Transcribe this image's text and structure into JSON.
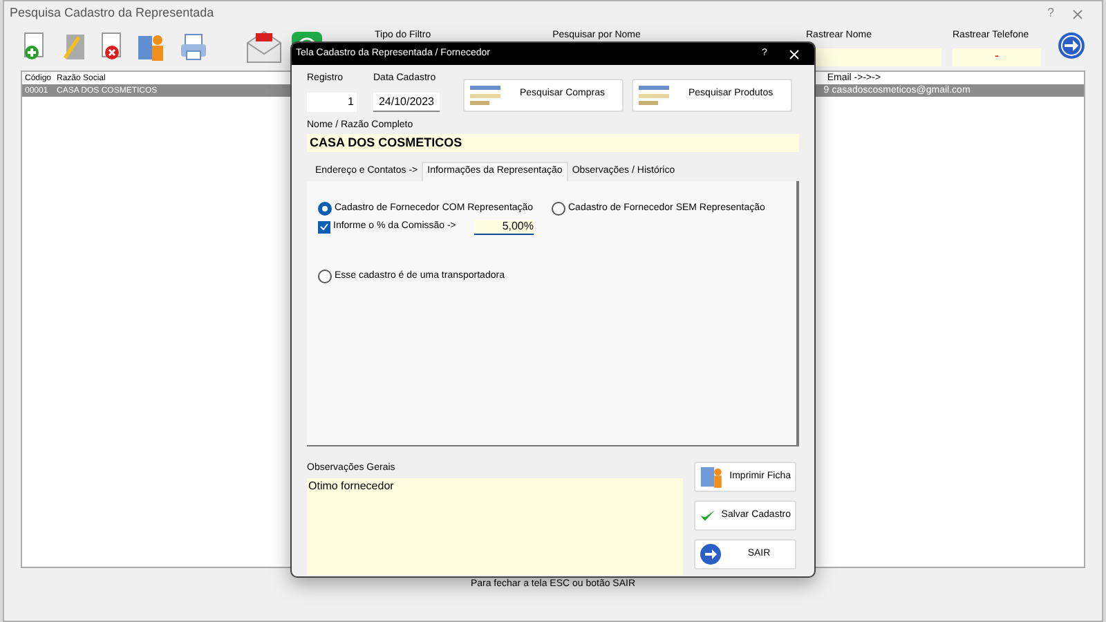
{
  "window": {
    "title": "Pesquisa Cadastro da Representada",
    "help": "?"
  },
  "filters": {
    "type_label": "Tipo do Filtro",
    "search_label": "Pesquisar por Nome",
    "track_name_label": "Rastrear Nome",
    "track_phone_label": "Rastrear Telefone",
    "track_phone_value": "-"
  },
  "table": {
    "columns": [
      "Código",
      "Razão Social",
      "Email ->->->"
    ],
    "rows": [
      {
        "code": "00001",
        "name": "CASA DOS COSMETICOS",
        "column_3": "9",
        "email": "casadoscosmeticos@gmail.com",
        "selected": true
      }
    ]
  },
  "status_bar": "Para fechar a tela ESC ou botão SAIR",
  "dialog": {
    "title": "Tela Cadastro da Representada / Fornecedor",
    "help": "?",
    "registro_label": "Registro",
    "registro": "1",
    "date_label": "Data Cadastro",
    "date": "24/10/2023",
    "top_buttons": [
      "Pesquisar Compras",
      "Pesquisar Produtos"
    ],
    "name_label": "Nome / Razão Completo",
    "name": "CASA DOS COSMETICOS",
    "tabs": [
      {
        "label": "Endereço e Contatos ->",
        "selected": false
      },
      {
        "label": "Informações da Representação",
        "selected": true
      },
      {
        "label": "Observações / Histórico",
        "selected": false
      }
    ],
    "radios": [
      {
        "label": "Cadastro de Fornecedor COM Representação",
        "selected": true
      },
      {
        "label": "Cadastro de Fornecedor SEM Representação",
        "selected": false
      }
    ],
    "commission": {
      "label": "Informe o % da Comissão ->",
      "checked": true,
      "value": "5,00%"
    },
    "carrier": {
      "label": "Esse cadastro é de uma transportadora",
      "selected": false
    },
    "notes_label": "Observações Gerais",
    "notes": "Otimo fornecedor",
    "actions": [
      {
        "kind": "print",
        "label": "Imprimir Ficha"
      },
      {
        "kind": "save",
        "label": "Salvar Cadastro"
      },
      {
        "kind": "exit",
        "label": "SAIR"
      }
    ]
  }
}
